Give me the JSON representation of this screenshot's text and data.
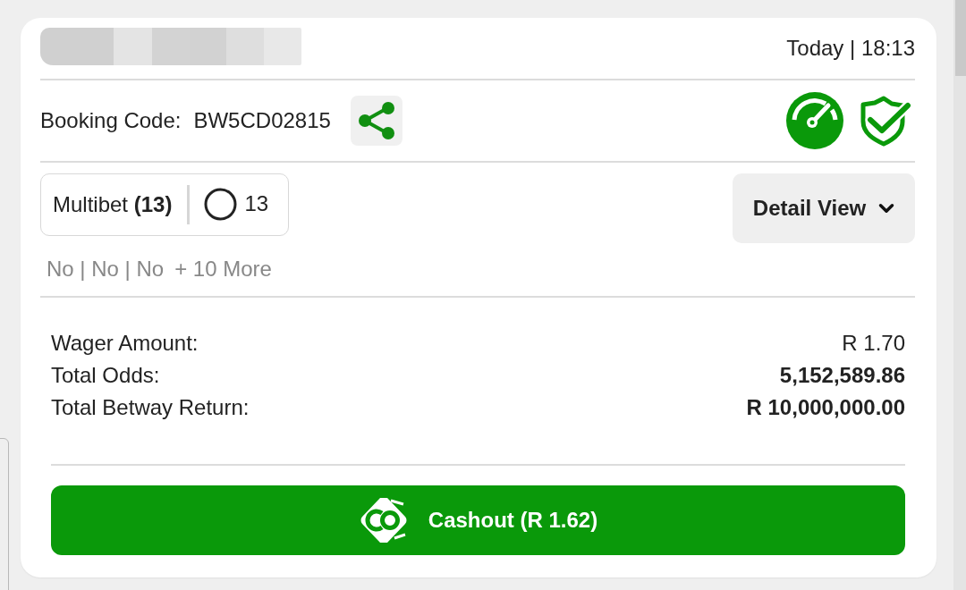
{
  "header": {
    "timestamp": "Today | 18:13"
  },
  "booking": {
    "label": "Booking Code:",
    "code": "BW5CD02815"
  },
  "bet_type": {
    "label": "Multibet **(13)**",
    "open_count": "13"
  },
  "view_button": {
    "label": "Detail View"
  },
  "selections": {
    "picks": "No | No | No",
    "more": "+ 10 More"
  },
  "summary": [
    {
      "label": "Wager Amount:",
      "value": "R 1.70",
      "emphasized": false
    },
    {
      "label": "Total Odds:",
      "value": "5,152,589.86",
      "emphasized": true
    },
    {
      "label": "Total Betway Return:",
      "value": "R 10,000,000.00",
      "emphasized": true
    }
  ],
  "cashout_button": {
    "label": "Cashout (R 1.62)"
  }
}
